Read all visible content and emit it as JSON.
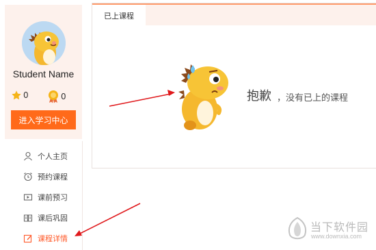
{
  "profile": {
    "student_name": "Student Name",
    "star_count": "0",
    "medal_count": "0",
    "enter_button_label": "进入学习中心"
  },
  "nav": {
    "items": [
      {
        "label": "个人主页",
        "icon": "person-icon"
      },
      {
        "label": "预约课程",
        "icon": "alarm-clock-icon"
      },
      {
        "label": "课前预习",
        "icon": "video-preview-icon"
      },
      {
        "label": "课后巩固",
        "icon": "book-icon"
      },
      {
        "label": "课程详情",
        "icon": "edit-icon",
        "active": true
      }
    ]
  },
  "main": {
    "tab_label": "已上课程",
    "empty_title": "抱歉",
    "empty_desc": "，没有已上的课程"
  },
  "watermark": {
    "title": "当下软件园",
    "url": "www.downxia.com"
  },
  "colors": {
    "accent": "#ff6a1a",
    "active_nav": "#ff5a2a",
    "panel_bg": "#fdf1ec",
    "arrow": "#e0191c"
  }
}
